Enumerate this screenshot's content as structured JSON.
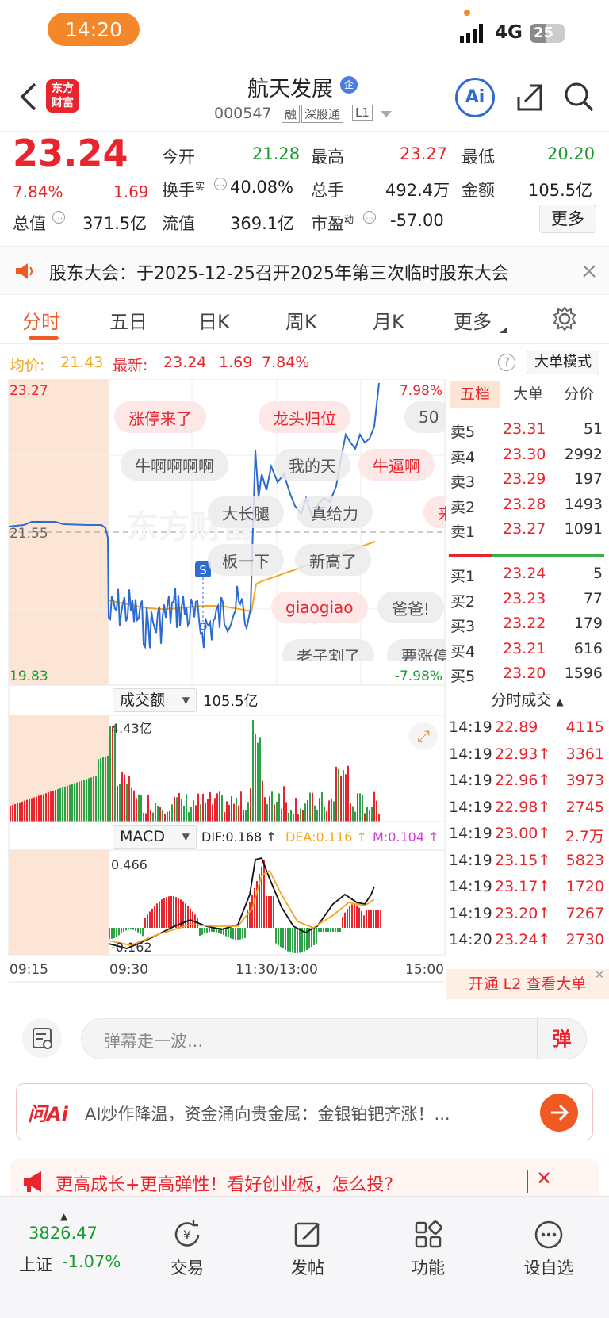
{
  "status_bar": {
    "time": "14:20",
    "network": "4G",
    "battery": "25"
  },
  "header": {
    "title": "航天发展",
    "title_badge": "企",
    "code": "000547",
    "tags": [
      "融",
      "深股通",
      "L1"
    ],
    "logo_text": [
      "东方",
      "财富"
    ],
    "ai_label": "Ai"
  },
  "quote": {
    "price": "23.24",
    "change_pct": "7.84%",
    "change": "1.69",
    "open_label": "今开",
    "open": "21.28",
    "high_label": "最高",
    "high": "23.27",
    "low_label": "最低",
    "low": "20.20",
    "turnover_label": "换手",
    "turnover_sup": "实",
    "turnover": "40.08%",
    "volume_label": "总手",
    "volume": "492.4万",
    "amount_label": "金额",
    "amount": "105.5亿",
    "mktcap_label": "总值",
    "mktcap": "371.5亿",
    "float_label": "流值",
    "float": "369.1亿",
    "pe_label": "市盈",
    "pe_sup": "动",
    "pe": "-57.00",
    "more_label": "更多"
  },
  "notice": {
    "text": "股东大会：于2025-12-25召开2025年第三次临时股东大会"
  },
  "tabs": [
    "分时",
    "五日",
    "日K",
    "周K",
    "月K",
    "更多"
  ],
  "active_tab": "分时",
  "summary": {
    "avg_label": "均价:",
    "avg": "21.43",
    "latest_label": "最新:",
    "latest": "23.24",
    "change": "1.69",
    "change_pct": "7.84%",
    "big_order_mode": "大单模式"
  },
  "price_chart": {
    "y_top": "23.27",
    "y_mid": "21.55",
    "y_bottom": "19.83",
    "pct_top": "7.98%",
    "pct_bottom": "-7.98%",
    "watermark": "东方财富",
    "signal": "S"
  },
  "bubbles": [
    {
      "text": "涨停来了",
      "style": "pink"
    },
    {
      "text": "龙头归位",
      "style": "pink"
    },
    {
      "text": "50",
      "style": "gray"
    },
    {
      "text": "牛啊啊啊啊",
      "style": "gray"
    },
    {
      "text": "我的天",
      "style": "gray"
    },
    {
      "text": "牛逼啊",
      "style": "pink"
    },
    {
      "text": "大长腿",
      "style": "gray"
    },
    {
      "text": "真给力",
      "style": "gray"
    },
    {
      "text": "来",
      "style": "pink"
    },
    {
      "text": "板一下",
      "style": "gray"
    },
    {
      "text": "新高了",
      "style": "gray"
    },
    {
      "text": "giaogiao",
      "style": "pink"
    },
    {
      "text": "爸爸!",
      "style": "gray"
    },
    {
      "text": "老子割了",
      "style": "gray"
    },
    {
      "text": "要涨停",
      "style": "gray"
    }
  ],
  "volume_panel": {
    "selector": "成交额",
    "total": "105.5亿",
    "max": "4.43亿"
  },
  "macd_panel": {
    "selector": "MACD",
    "dif": "DIF:0.168 ↑",
    "dea": "DEA:0.116 ↑",
    "m": "M:0.104 ↑",
    "max": "0.466",
    "min": "-0.162"
  },
  "time_axis": [
    "09:15",
    "09:30",
    "11:30/13:00",
    "15:00"
  ],
  "orderbook": {
    "tabs": [
      "五档",
      "大单",
      "分价"
    ],
    "asks": [
      {
        "label": "卖5",
        "price": "23.31",
        "vol": "51"
      },
      {
        "label": "卖4",
        "price": "23.30",
        "vol": "2992"
      },
      {
        "label": "卖3",
        "price": "23.29",
        "vol": "197"
      },
      {
        "label": "卖2",
        "price": "23.28",
        "vol": "1493"
      },
      {
        "label": "卖1",
        "price": "23.27",
        "vol": "1091"
      }
    ],
    "bids": [
      {
        "label": "买1",
        "price": "23.24",
        "vol": "5"
      },
      {
        "label": "买2",
        "price": "23.23",
        "vol": "77"
      },
      {
        "label": "买3",
        "price": "23.22",
        "vol": "179"
      },
      {
        "label": "买4",
        "price": "23.21",
        "vol": "616"
      },
      {
        "label": "买5",
        "price": "23.20",
        "vol": "1596"
      }
    ]
  },
  "ticks": {
    "header": "分时成交",
    "rows": [
      {
        "time": "14:19",
        "price": "22.89",
        "vol": "4115",
        "color": "red"
      },
      {
        "time": "14:19",
        "price": "22.93↑",
        "vol": "3361",
        "color": "red"
      },
      {
        "time": "14:19",
        "price": "22.96↑",
        "vol": "3973",
        "color": "red"
      },
      {
        "time": "14:19",
        "price": "22.98↑",
        "vol": "2745",
        "color": "red"
      },
      {
        "time": "14:19",
        "price": "23.00↑",
        "vol": "2.7万",
        "color": "red"
      },
      {
        "time": "14:19",
        "price": "23.15↑",
        "vol": "5823",
        "color": "red"
      },
      {
        "time": "14:19",
        "price": "23.17↑",
        "vol": "1720",
        "color": "red"
      },
      {
        "time": "14:19",
        "price": "23.20↑",
        "vol": "7267",
        "color": "red"
      },
      {
        "time": "14:20",
        "price": "23.24↑",
        "vol": "2730",
        "color": "red"
      }
    ],
    "l2_promo": "开通 L2 查看大单"
  },
  "comment": {
    "placeholder": "弹幕走一波...",
    "send": "弹"
  },
  "ai_bar": {
    "brand": "问Ai",
    "text": "AI炒作降温，资金涌向贵金属：金银铂钯齐涨！..."
  },
  "promo": {
    "text": "更高成长+更高弹性！看好创业板，怎么投?"
  },
  "bottom_nav": {
    "index_value": "3826.47",
    "index_name": "上证",
    "index_change": "-1.07%",
    "items": [
      {
        "label": "交易",
        "icon": "yuan-cycle-icon"
      },
      {
        "label": "发帖",
        "icon": "edit-icon"
      },
      {
        "label": "功能",
        "icon": "grid-icon"
      },
      {
        "label": "设自选",
        "icon": "more-icon"
      }
    ]
  },
  "colors": {
    "up": "#e8242c",
    "down": "#1a9b2f",
    "accent": "#f5872b",
    "price_line": "#2e6bd1",
    "avg_line": "#f5a623"
  }
}
